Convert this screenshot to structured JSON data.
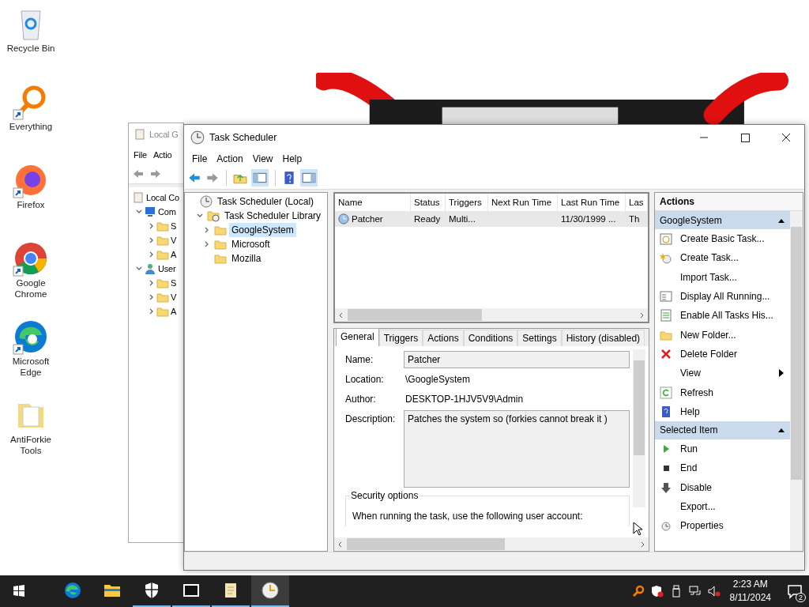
{
  "desktop_icons": [
    {
      "label": "Recycle Bin",
      "kind": "recycle",
      "shortcut": false
    },
    {
      "label": "Everything",
      "kind": "everything",
      "shortcut": true
    },
    {
      "label": "Firefox",
      "kind": "firefox",
      "shortcut": true
    },
    {
      "label": "Google Chrome",
      "kind": "chrome",
      "shortcut": true
    },
    {
      "label": "Microsoft Edge",
      "kind": "edge",
      "shortcut": true
    },
    {
      "label": "AntiForkie Tools",
      "kind": "folder",
      "shortcut": false
    }
  ],
  "back_window": {
    "title": "Local G",
    "menu": [
      "File",
      "Actio"
    ],
    "tree": [
      {
        "label": "Local Co",
        "kind": "policy",
        "children": [
          {
            "label": "Com",
            "kind": "computer",
            "expanded": true,
            "children": [
              {
                "label": "S",
                "kind": "folder",
                "expanded": false
              },
              {
                "label": "V",
                "kind": "folder",
                "expanded": false
              },
              {
                "label": "A",
                "kind": "folder",
                "expanded": false
              }
            ]
          },
          {
            "label": "User",
            "kind": "user",
            "expanded": true,
            "children": [
              {
                "label": "S",
                "kind": "folder",
                "expanded": false
              },
              {
                "label": "V",
                "kind": "folder",
                "expanded": false
              },
              {
                "label": "A",
                "kind": "folder",
                "expanded": false
              }
            ]
          }
        ]
      }
    ]
  },
  "main_window": {
    "title": "Task Scheduler",
    "menu": [
      "File",
      "Action",
      "View",
      "Help"
    ],
    "tree": [
      {
        "label": "Task Scheduler (Local)",
        "kind": "clock",
        "selected": false,
        "children": [
          {
            "label": "Task Scheduler Library",
            "kind": "library",
            "selected": false,
            "expanded": true,
            "children": [
              {
                "label": "GoogleSystem",
                "kind": "folder",
                "selected": true,
                "expanded": false
              },
              {
                "label": "Microsoft",
                "kind": "folder",
                "selected": false,
                "expanded": false
              },
              {
                "label": "Mozilla",
                "kind": "folder",
                "selected": false
              }
            ]
          }
        ]
      }
    ],
    "task_table": {
      "columns": [
        "Name",
        "Status",
        "Triggers",
        "Next Run Time",
        "Last Run Time",
        "Las"
      ],
      "rows": [
        {
          "name": "Patcher",
          "status": "Ready",
          "triggers": "Multi...",
          "last_run_time": "11/30/1999 ...",
          "column_6": "Th",
          "selected": true
        }
      ]
    },
    "tabs": [
      {
        "label": "General",
        "selected": true
      },
      {
        "label": "Triggers",
        "selected": false
      },
      {
        "label": "Actions",
        "selected": false
      },
      {
        "label": "Conditions",
        "selected": false
      },
      {
        "label": "Settings",
        "selected": false
      },
      {
        "label": "History (disabled)",
        "selected": false
      }
    ],
    "general": {
      "name_label": "Name:",
      "name": "Patcher",
      "location_label": "Location:",
      "location": "\\GoogleSystem",
      "author_label": "Author:",
      "author": "DESKTOP-1HJV5V9\\Admin",
      "description_label": "Description:",
      "description": "Patches the system so (forkies cannot break it )",
      "security_title": "Security options",
      "security_text": "When running the task, use the following user account:"
    },
    "actions": {
      "title": "Actions",
      "sections": [
        {
          "title": "GoogleSystem",
          "expanded": true,
          "items": [
            {
              "label": "Create Basic Task...",
              "kind": "basic-task"
            },
            {
              "label": "Create Task...",
              "kind": "task"
            },
            {
              "label": "Import Task...",
              "kind": "none"
            },
            {
              "label": "Display All Running...",
              "kind": "running"
            },
            {
              "label": "Enable All Tasks His...",
              "kind": "history"
            },
            {
              "label": "New Folder...",
              "kind": "new-folder"
            },
            {
              "label": "Delete Folder",
              "kind": "delete"
            },
            {
              "label": "View",
              "kind": "submenu"
            },
            {
              "label": "Refresh",
              "kind": "refresh"
            },
            {
              "label": "Help",
              "kind": "help"
            }
          ]
        },
        {
          "title": "Selected Item",
          "expanded": true,
          "items": [
            {
              "label": "Run",
              "kind": "run"
            },
            {
              "label": "End",
              "kind": "end"
            },
            {
              "label": "Disable",
              "kind": "disable"
            },
            {
              "label": "Export...",
              "kind": "none"
            },
            {
              "label": "Properties",
              "kind": "properties"
            }
          ]
        }
      ]
    }
  },
  "taskbar": {
    "apps": [
      {
        "kind": "edge",
        "running": false,
        "selected": false
      },
      {
        "kind": "explorer",
        "running": false,
        "selected": false
      },
      {
        "kind": "security",
        "running": true,
        "selected": false
      },
      {
        "kind": "archive",
        "running": true,
        "selected": false
      },
      {
        "kind": "notepad",
        "running": true,
        "selected": false
      },
      {
        "kind": "clock",
        "running": true,
        "selected": true
      }
    ],
    "time": "2:23 AM",
    "date": "8/11/2024",
    "notifications": "2"
  }
}
